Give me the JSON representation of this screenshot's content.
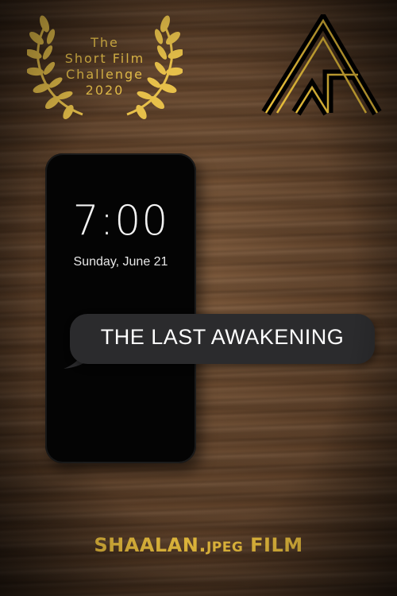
{
  "festival": {
    "lines": [
      "The",
      "Short Film",
      "Challenge",
      "2020"
    ],
    "icon": "laurel-wreath-icon",
    "color": "#e7c04a"
  },
  "logo": {
    "icon": "monogram-triangle-logo",
    "color": "#e6bd3a"
  },
  "phone": {
    "time": "7:00",
    "date": "Sunday, June 21"
  },
  "message": {
    "text": "THE LAST AWAKENING"
  },
  "credit": {
    "name": "SHAALAN.",
    "ext": "JPEG",
    "suffix": " FILM",
    "color": "#e3b93c"
  }
}
